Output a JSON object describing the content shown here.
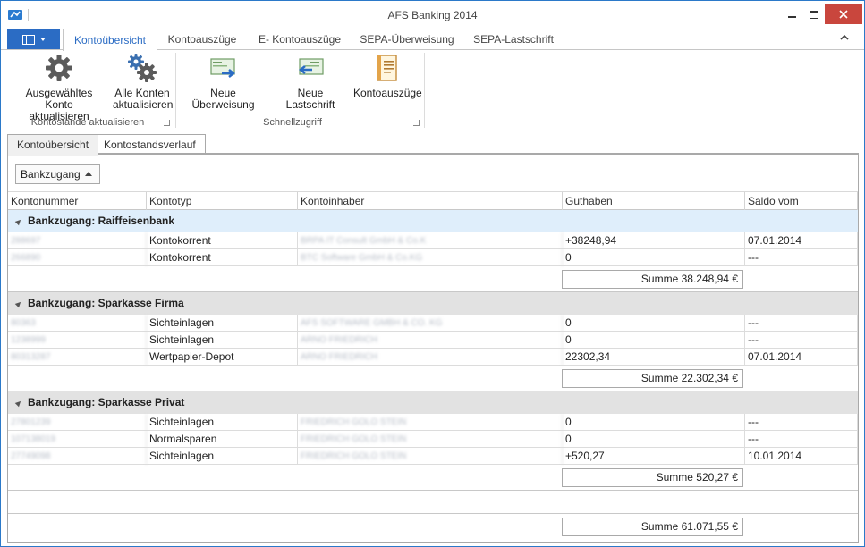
{
  "window": {
    "title": "AFS Banking 2014"
  },
  "ribbon_tabs": [
    "Kontoübersicht",
    "Kontoauszüge",
    "E- Kontoauszüge",
    "SEPA-Überweisung",
    "SEPA-Lastschrift"
  ],
  "ribbon": {
    "btn_update_selected": [
      "Ausgewähltes Konto",
      "aktualisieren"
    ],
    "btn_update_all": [
      "Alle Konten",
      "aktualisieren"
    ],
    "group1_label": "Kontostände aktualisieren",
    "btn_new_transfer": "Neue Überweisung",
    "btn_new_debit": "Neue Lastschrift",
    "btn_statements": "Kontoauszüge",
    "group2_label": "Schnellzugriff"
  },
  "doc_tabs": [
    "Kontoübersicht",
    "Kontostandsverlauf"
  ],
  "group_by_chip": "Bankzugang",
  "columns": [
    "Kontonummer",
    "Kontotyp",
    "Kontoinhaber",
    "Guthaben",
    "Saldo vom"
  ],
  "groups": [
    {
      "title": "Bankzugang: Raiffeisenbank",
      "rows": [
        {
          "number": "288697",
          "type": "Kontokorrent",
          "holder": "BRPA IT Consult GmbH & Co.K",
          "balance": "+38248,94",
          "date": "07.01.2014"
        },
        {
          "number": "266890",
          "type": "Kontokorrent",
          "holder": "BTC Software GmbH & Co.KG",
          "balance": "0",
          "date": "---"
        }
      ],
      "sum": "Summe 38.248,94 €"
    },
    {
      "title": "Bankzugang: Sparkasse Firma",
      "rows": [
        {
          "number": "80363",
          "type": "Sichteinlagen",
          "holder": "AFS SOFTWARE GMBH & CO. KG",
          "balance": "0",
          "date": "---"
        },
        {
          "number": "1238999",
          "type": "Sichteinlagen",
          "holder": "ARNO FRIEDRICH",
          "balance": "0",
          "date": "---"
        },
        {
          "number": "80313287",
          "type": "Wertpapier-Depot",
          "holder": "ARNO FRIEDRICH",
          "balance": "22302,34",
          "date": "07.01.2014"
        }
      ],
      "sum": "Summe 22.302,34 €"
    },
    {
      "title": "Bankzugang: Sparkasse Privat",
      "rows": [
        {
          "number": "27801239",
          "type": "Sichteinlagen",
          "holder": "FRIEDRICH GOLO STEIN",
          "balance": "0",
          "date": "---"
        },
        {
          "number": "107138019",
          "type": "Normalsparen",
          "holder": "FRIEDRICH GOLO STEIN",
          "balance": "0",
          "date": "---"
        },
        {
          "number": "27749098",
          "type": "Sichteinlagen",
          "holder": "FRIEDRICH GOLO STEIN",
          "balance": "+520,27",
          "date": "10.01.2014"
        }
      ],
      "sum": "Summe 520,27 €"
    }
  ],
  "total_sum": "Summe 61.071,55 €",
  "colors": {
    "accent": "#2b6cc4",
    "close": "#c9463d",
    "group_bg": "#e2e2e2",
    "group_selected": "#dfeefb"
  }
}
